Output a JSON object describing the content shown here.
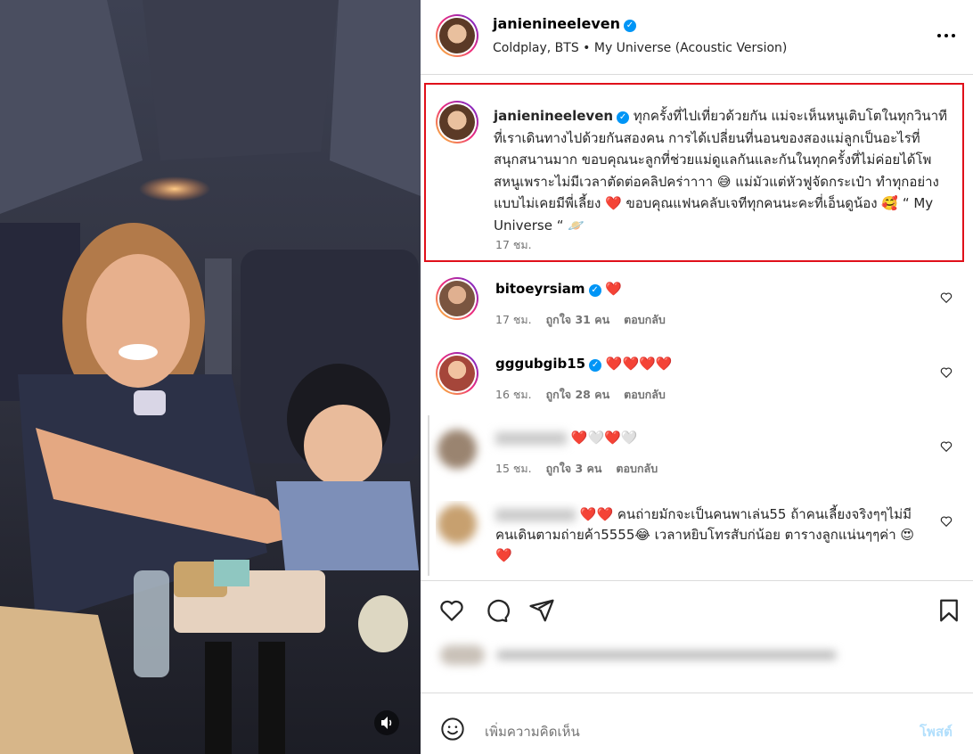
{
  "post": {
    "username": "janienineeleven",
    "audio": "Coldplay, BTS • My Universe (Acoustic Version)",
    "caption": {
      "username": "janienineeleven",
      "text": "ทุกครั้งที่ไปเที่ยวด้วยกัน แม่จะเห็นหนูเติบโตในทุกวินาทีที่เราเดินทางไปด้วยกันสองคน การได้เปลี่ยนที่นอนของสองแม่ลูกเป็นอะไรที่สนุกสนานมาก ขอบคุณนะลูกที่ช่วยแม่ดูแลกันและกันในทุกครั้งที่ไม่ค่อยได้โพสหนูเพราะไม่มีเวลาตัดต่อคลิปคร่าาาา 😅 แม่มัวแต่หัวฟูจัดกระเป๋า ทำทุกอย่างแบบไม่เคยมีพี่เลี้ยง ❤️ ขอบคุณแฟนคลับเจทีทุกคนนะคะที่เอ็นดูน้อง 🥰 “ My Universe “ 🪐",
      "time": "17 ชม."
    },
    "more_icon": "more-horizontal-icon"
  },
  "comments": [
    {
      "username": "bitoeyrsiam",
      "text": "❤️",
      "time": "17 ชม.",
      "likes": "ถูกใจ 31 คน",
      "reply": "ตอบกลับ",
      "verified": true
    },
    {
      "username": "gggubgib15",
      "text": "❤️❤️❤️❤️",
      "time": "16 ชม.",
      "likes": "ถูกใจ 28 คน",
      "reply": "ตอบกลับ",
      "verified": true
    },
    {
      "username": "blurred_user",
      "text": "❤️🤍❤️🤍",
      "time": "15 ชม.",
      "likes": "ถูกใจ 3 คน",
      "reply": "ตอบกลับ",
      "verified": false
    },
    {
      "username": "blurred_user2",
      "text": "❤️❤️ คนถ่ายมักจะเป็นคนพาเล่น55 ถ้าคนเลี้ยงจริงๆๆไม่มีคนเดินตามถ่ายค้า5555😂 เวลาหยิบโทรสับก่น้อย ตารางลูกแน่นๆๆค่า 😍❤️",
      "time": "",
      "likes": "",
      "reply": "",
      "verified": false
    }
  ],
  "actions": {
    "like_icon": "heart-outline-icon",
    "comment_icon": "comment-icon",
    "share_icon": "send-icon",
    "save_icon": "bookmark-icon"
  },
  "composer": {
    "placeholder": "เพิ่มความคิดเห็น",
    "post_label": "โพสต์",
    "emoji_icon": "emoji-icon"
  },
  "media": {
    "sound_icon": "speaker-icon"
  },
  "colors": {
    "highlight_border": "#e0101a",
    "verified": "#0095f6",
    "heart": "#e0245e",
    "post_disabled": "#b2dffc"
  }
}
